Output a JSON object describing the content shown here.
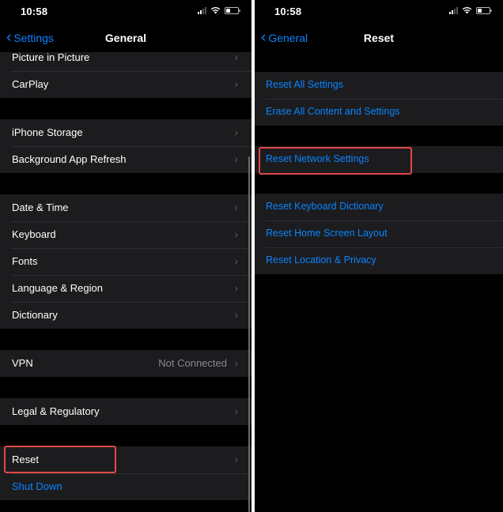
{
  "left": {
    "status": {
      "time": "10:58"
    },
    "nav": {
      "back_label": "Settings",
      "title": "General"
    },
    "groups": [
      {
        "rows": [
          {
            "label": "Picture in Picture"
          },
          {
            "label": "CarPlay"
          }
        ]
      },
      {
        "rows": [
          {
            "label": "iPhone Storage"
          },
          {
            "label": "Background App Refresh"
          }
        ]
      },
      {
        "rows": [
          {
            "label": "Date & Time"
          },
          {
            "label": "Keyboard"
          },
          {
            "label": "Fonts"
          },
          {
            "label": "Language & Region"
          },
          {
            "label": "Dictionary"
          }
        ]
      },
      {
        "rows": [
          {
            "label": "VPN",
            "value": "Not Connected"
          }
        ]
      },
      {
        "rows": [
          {
            "label": "Legal & Regulatory"
          }
        ]
      },
      {
        "rows": [
          {
            "label": "Reset"
          },
          {
            "label": "Shut Down"
          }
        ]
      }
    ]
  },
  "right": {
    "status": {
      "time": "10:58"
    },
    "nav": {
      "back_label": "General",
      "title": "Reset"
    },
    "groups": [
      {
        "rows": [
          {
            "label": "Reset All Settings"
          },
          {
            "label": "Erase All Content and Settings"
          }
        ]
      },
      {
        "rows": [
          {
            "label": "Reset Network Settings"
          }
        ]
      },
      {
        "rows": [
          {
            "label": "Reset Keyboard Dictionary"
          },
          {
            "label": "Reset Home Screen Layout"
          },
          {
            "label": "Reset Location & Privacy"
          }
        ]
      }
    ]
  },
  "icons": {
    "back": "chevron-left-icon",
    "row_arrow": "chevron-right-icon",
    "signal": "cellular-signal-icon",
    "wifi": "wifi-icon",
    "battery": "battery-icon"
  },
  "colors": {
    "background": "#000000",
    "cell": "#1c1c1e",
    "accent": "#0a84ff",
    "secondary_text": "#8a8a8e",
    "highlight": "#e04848"
  }
}
